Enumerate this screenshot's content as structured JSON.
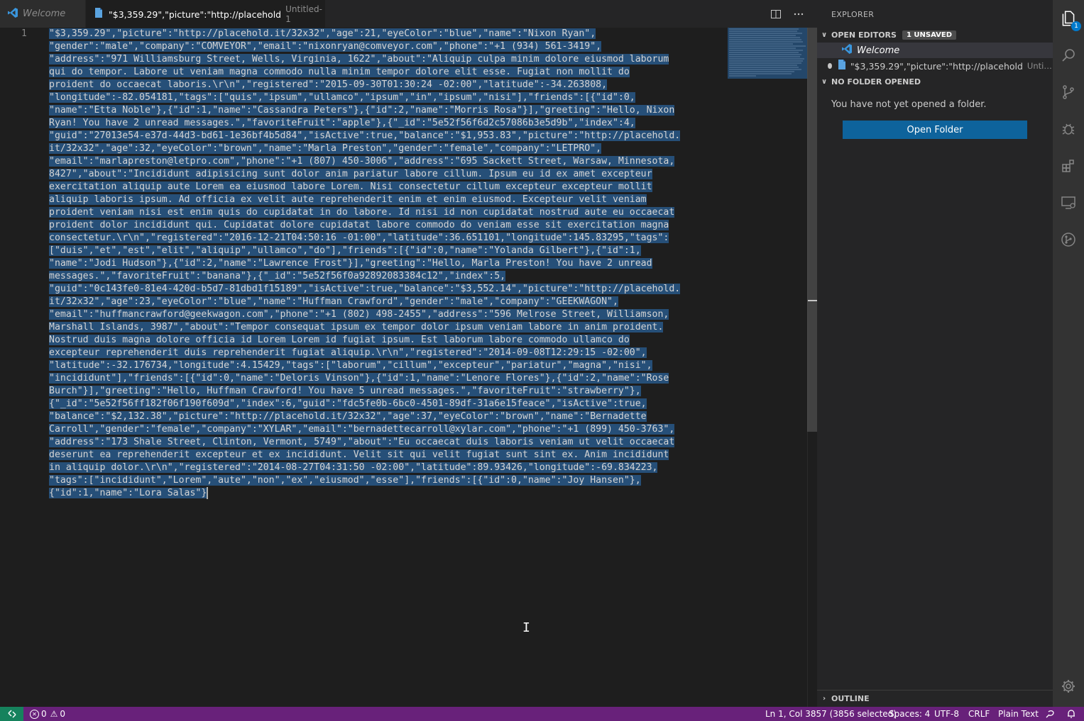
{
  "tabs": {
    "welcome_label": "Welcome",
    "untitled_label": "\"$3,359.29\",\"picture\":\"http://placehold",
    "untitled_desc": "Untitled-1"
  },
  "editor": {
    "line_number": "1",
    "lines": [
      "\"$3,359.29\",\"picture\":\"http://placehold.it/32x32\",\"age\":21,\"eyeColor\":\"blue\",\"name\":\"Nixon Ryan\",",
      "\"gender\":\"male\",\"company\":\"COMVEYOR\",\"email\":\"nixonryan@comveyor.com\",\"phone\":\"+1 (934) 561-3419\",",
      "\"address\":\"971 Williamsburg Street, Wells, Virginia, 1622\",\"about\":\"Aliquip culpa minim dolore eiusmod laborum",
      "qui do tempor. Labore ut veniam magna commodo nulla minim tempor dolore elit esse. Fugiat non mollit do",
      "proident do occaecat laboris.\\r\\n\",\"registered\":\"2015-09-30T01:30:24 -02:00\",\"latitude\":-34.263808,",
      "\"longitude\":-82.054181,\"tags\":[\"quis\",\"ipsum\",\"ullamco\",\"ipsum\",\"in\",\"ipsum\",\"nisi\"],\"friends\":[{\"id\":0,",
      "\"name\":\"Etta Noble\"},{\"id\":1,\"name\":\"Cassandra Peters\"},{\"id\":2,\"name\":\"Morris Rosa\"}],\"greeting\":\"Hello, Nixon",
      "Ryan! You have 2 unread messages.\",\"favoriteFruit\":\"apple\"},{\"_id\":\"5e52f56f6d2c57086b3e5d9b\",\"index\":4,",
      "\"guid\":\"27013e54-e37d-44d3-bd61-1e36bf4b5d84\",\"isActive\":true,\"balance\":\"$1,953.83\",\"picture\":\"http://placehold.",
      "it/32x32\",\"age\":32,\"eyeColor\":\"brown\",\"name\":\"Marla Preston\",\"gender\":\"female\",\"company\":\"LETPRO\",",
      "\"email\":\"marlapreston@letpro.com\",\"phone\":\"+1 (807) 450-3006\",\"address\":\"695 Sackett Street, Warsaw, Minnesota,",
      "8427\",\"about\":\"Incididunt adipisicing sunt dolor anim pariatur labore cillum. Ipsum eu id ex amet excepteur",
      "exercitation aliquip aute Lorem ea eiusmod labore Lorem. Nisi consectetur cillum excepteur excepteur mollit",
      "aliquip laboris ipsum. Ad officia ex velit aute reprehenderit enim et enim eiusmod. Excepteur velit veniam",
      "proident veniam nisi est enim quis do cupidatat in do labore. Id nisi id non cupidatat nostrud aute eu occaecat",
      "proident dolor incididunt qui. Cupidatat dolore cupidatat labore commodo do veniam esse sit exercitation magna",
      "consectetur.\\r\\n\",\"registered\":\"2016-12-21T04:50:16 -01:00\",\"latitude\":36.651101,\"longitude\":145.83295,\"tags\":",
      "[\"duis\",\"et\",\"est\",\"elit\",\"aliquip\",\"ullamco\",\"do\"],\"friends\":[{\"id\":0,\"name\":\"Yolanda Gilbert\"},{\"id\":1,",
      "\"name\":\"Jodi Hudson\"},{\"id\":2,\"name\":\"Lawrence Frost\"}],\"greeting\":\"Hello, Marla Preston! You have 2 unread",
      "messages.\",\"favoriteFruit\":\"banana\"},{\"_id\":\"5e52f56f0a92892083384c12\",\"index\":5,",
      "\"guid\":\"0c143fe0-81e4-420d-b5d7-81dbd1f15189\",\"isActive\":true,\"balance\":\"$3,552.14\",\"picture\":\"http://placehold.",
      "it/32x32\",\"age\":23,\"eyeColor\":\"blue\",\"name\":\"Huffman Crawford\",\"gender\":\"male\",\"company\":\"GEEKWAGON\",",
      "\"email\":\"huffmancrawford@geekwagon.com\",\"phone\":\"+1 (802) 498-2455\",\"address\":\"596 Melrose Street, Williamson,",
      "Marshall Islands, 3987\",\"about\":\"Tempor consequat ipsum ex tempor dolor ipsum veniam labore in anim proident.",
      "Nostrud duis magna dolore officia id Lorem Lorem id fugiat ipsum. Est laborum labore commodo ullamco do",
      "excepteur reprehenderit duis reprehenderit fugiat aliquip.\\r\\n\",\"registered\":\"2014-09-08T12:29:15 -02:00\",",
      "\"latitude\":-32.176734,\"longitude\":4.15429,\"tags\":[\"laborum\",\"cillum\",\"excepteur\",\"pariatur\",\"magna\",\"nisi\",",
      "\"incididunt\"],\"friends\":[{\"id\":0,\"name\":\"Deloris Vinson\"},{\"id\":1,\"name\":\"Lenore Flores\"},{\"id\":2,\"name\":\"Rose",
      "Burch\"}],\"greeting\":\"Hello, Huffman Crawford! You have 5 unread messages.\",\"favoriteFruit\":\"strawberry\"},",
      "{\"_id\":\"5e52f56ff182f06f190f609d\",\"index\":6,\"guid\":\"fdc5fe0b-6bc0-4501-89df-31a6e15feace\",\"isActive\":true,",
      "\"balance\":\"$2,132.38\",\"picture\":\"http://placehold.it/32x32\",\"age\":37,\"eyeColor\":\"brown\",\"name\":\"Bernadette",
      "Carroll\",\"gender\":\"female\",\"company\":\"XYLAR\",\"email\":\"bernadettecarroll@xylar.com\",\"phone\":\"+1 (899) 450-3763\",",
      "\"address\":\"173 Shale Street, Clinton, Vermont, 5749\",\"about\":\"Eu occaecat duis laboris veniam ut velit occaecat",
      "deserunt ea reprehenderit excepteur et ex incididunt. Velit sit qui velit fugiat sunt sint ex. Anim incididunt",
      "in aliquip dolor.\\r\\n\",\"registered\":\"2014-08-27T04:31:50 -02:00\",\"latitude\":89.93426,\"longitude\":-69.834223,",
      "\"tags\":[\"incididunt\",\"Lorem\",\"aute\",\"non\",\"ex\",\"eiusmod\",\"esse\"],\"friends\":[{\"id\":0,\"name\":\"Joy Hansen\"},",
      "{\"id\":1,\"name\":\"Lora Salas\"}"
    ]
  },
  "sidebar": {
    "title": "EXPLORER",
    "open_editors": {
      "header": "OPEN EDITORS",
      "badge": "1 UNSAVED",
      "items": [
        {
          "label": "Welcome",
          "desc": ""
        },
        {
          "label": "\"$3,359.29\",\"picture\":\"http://placehold",
          "desc": "Untitled-1"
        }
      ]
    },
    "no_folder": {
      "header": "NO FOLDER OPENED",
      "message": "You have not yet opened a folder.",
      "button": "Open Folder"
    },
    "outline": {
      "header": "OUTLINE"
    }
  },
  "activity_bar": {
    "explorer_badge": "1",
    "icons": [
      "files-icon",
      "search-icon",
      "source-control-icon",
      "debug-icon",
      "extensions-icon",
      "remote-explorer-icon",
      "git-graph-icon",
      "settings-gear-icon"
    ]
  },
  "status_bar": {
    "errors": "0",
    "warnings": "0",
    "cursor": "Ln 1, Col 3857 (3856 selected)",
    "spaces": "Spaces: 4",
    "encoding": "UTF-8",
    "eol": "CRLF",
    "language": "Plain Text"
  },
  "colors": {
    "status_bar": "#68217a",
    "remote": "#16825d",
    "selection": "#264f78",
    "button": "#0e639c",
    "accent": "#007acc"
  }
}
